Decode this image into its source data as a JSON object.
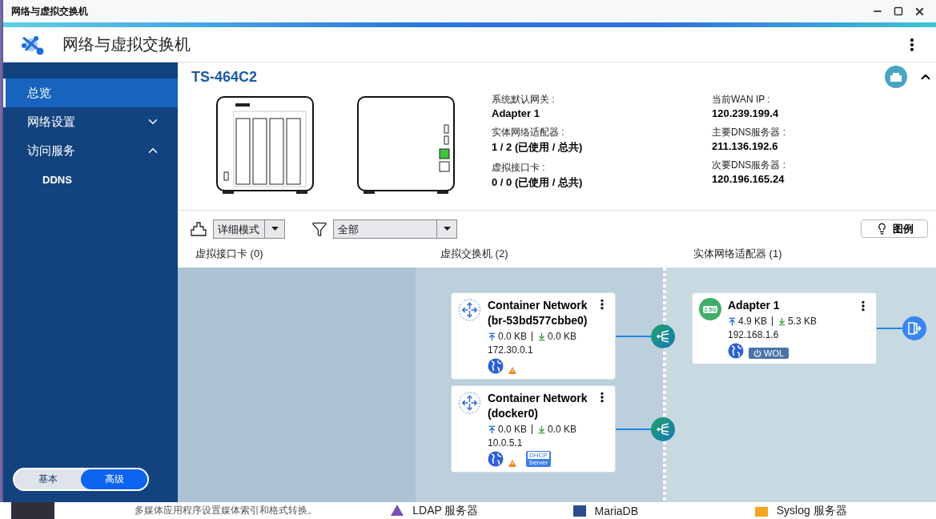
{
  "window": {
    "title": "网络与虚拟交换机"
  },
  "app": {
    "title": "网络与虚拟交换机"
  },
  "sidebar": {
    "items": [
      {
        "label": "总览",
        "selected": true
      },
      {
        "label": "网络设置",
        "selected": false,
        "expanded": false
      },
      {
        "label": "访问服务",
        "selected": false,
        "expanded": true,
        "children": [
          {
            "label": "DDNS",
            "selected": false
          }
        ]
      }
    ],
    "mode_toggle": [
      {
        "label": "基本",
        "selected": false
      },
      {
        "label": "高级",
        "selected": true
      }
    ]
  },
  "device": {
    "name": "TS-464C2",
    "info_columns": [
      [
        {
          "label": "系统默认网关 :",
          "value": "Adapter 1"
        },
        {
          "label": "实体网络适配器 :",
          "value": "1 / 2 (已使用 / 总共)"
        },
        {
          "label": "虚拟接口卡 :",
          "value": "0 / 0 (已使用 / 总共)"
        }
      ],
      [
        {
          "label": "当前WAN IP :",
          "value": "120.239.199.4"
        },
        {
          "label": "主要DNS服务器 :",
          "value": "211.136.192.6"
        },
        {
          "label": "次要DNS服务器 :",
          "value": "120.196.165.24"
        }
      ]
    ]
  },
  "toolbar": {
    "view_mode": "详细模式",
    "filter": "全部",
    "legend_button": "图例"
  },
  "columns": [
    {
      "title": "虚拟接口卡 (0)"
    },
    {
      "title": "虚拟交换机 (2)"
    },
    {
      "title": "实体网络适配器 (1)"
    }
  ],
  "switches": [
    {
      "name": "Container Network (br-53bd577cbbe0)",
      "upload": "0.0 KB",
      "download": "0.0 KB",
      "ip": "172.30.0.1",
      "warning": true
    },
    {
      "name": "Container Network (docker0)",
      "upload": "0.0 KB",
      "download": "0.0 KB",
      "ip": "10.0.5.1",
      "warning": true,
      "dhcp_badge": {
        "top": "DHCP",
        "bottom": "Server"
      }
    }
  ],
  "adapters": [
    {
      "name": "Adapter 1",
      "speed_badge": "2.5G",
      "upload": "4.9 KB",
      "download": "5.3 KB",
      "ip": "192.168.1.6",
      "wol_label": "WOL"
    }
  ],
  "background_apps": {
    "description": "多媒体应用程序设置媒体索引和格式转换。",
    "items": [
      {
        "label": "LDAP 服务器"
      },
      {
        "label": "MariaDB"
      },
      {
        "label": "Syslog 服务器"
      }
    ]
  }
}
